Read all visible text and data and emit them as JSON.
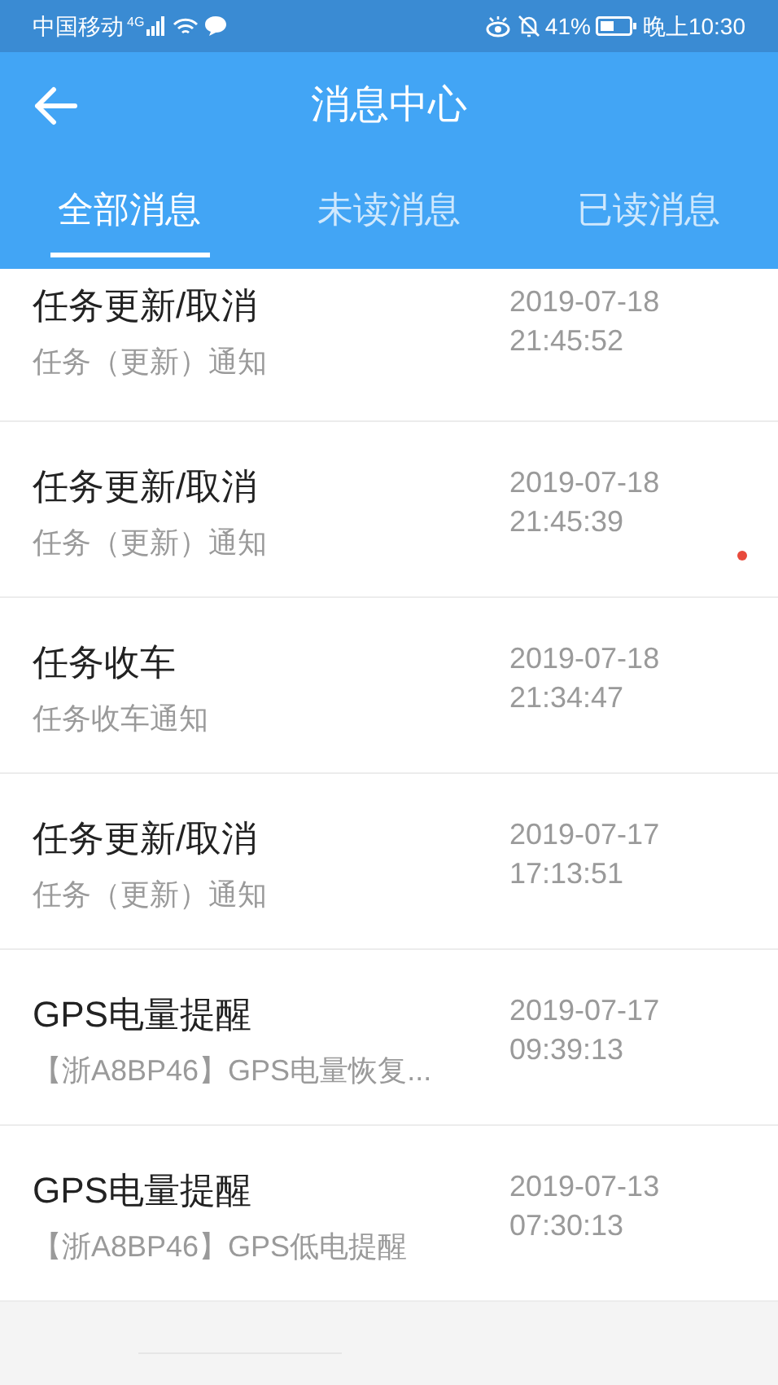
{
  "status_bar": {
    "carrier": "中国移动",
    "network": "4G",
    "battery": "41%",
    "time": "晚上10:30"
  },
  "header": {
    "title": "消息中心"
  },
  "tabs": [
    {
      "label": "全部消息",
      "selected": true
    },
    {
      "label": "未读消息",
      "selected": false
    },
    {
      "label": "已读消息",
      "selected": false
    }
  ],
  "messages": [
    {
      "title": "任务更新/取消",
      "summary": "任务（更新）通知",
      "date": "2019-07-18",
      "time": "21:45:52",
      "unread": false
    },
    {
      "title": "任务更新/取消",
      "summary": "任务（更新）通知",
      "date": "2019-07-18",
      "time": "21:45:39",
      "unread": true
    },
    {
      "title": "任务收车",
      "summary": "任务收车通知",
      "date": "2019-07-18",
      "time": "21:34:47",
      "unread": false
    },
    {
      "title": "任务更新/取消",
      "summary": "任务（更新）通知",
      "date": "2019-07-17",
      "time": "17:13:51",
      "unread": false
    },
    {
      "title": "GPS电量提醒",
      "summary": "【浙A8BP46】GPS电量恢复...",
      "date": "2019-07-17",
      "time": "09:39:13",
      "unread": false
    },
    {
      "title": "GPS电量提醒",
      "summary": "【浙A8BP46】GPS低电提醒",
      "date": "2019-07-13",
      "time": "07:30:13",
      "unread": false
    }
  ]
}
